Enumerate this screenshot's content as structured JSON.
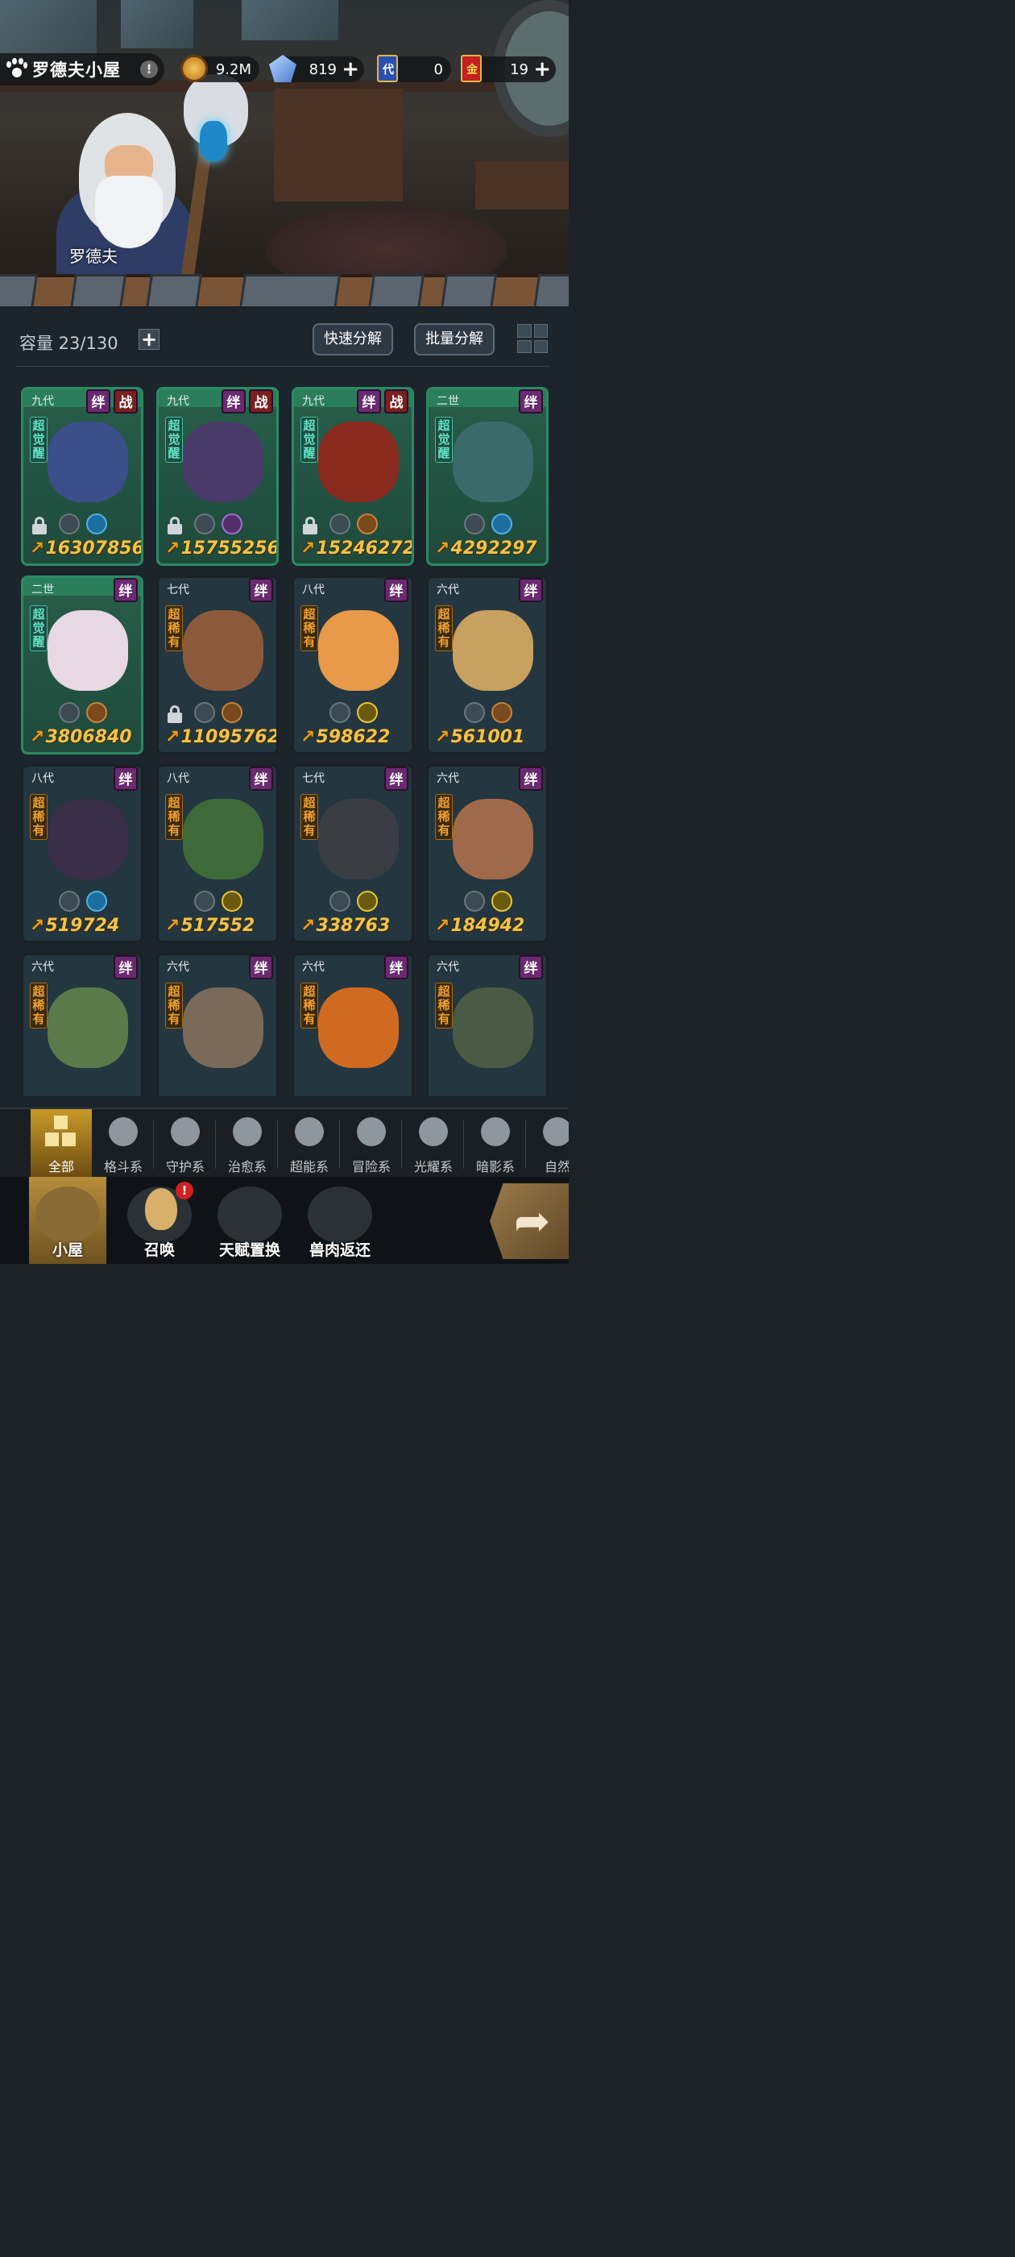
{
  "header": {
    "title": "罗德夫小屋",
    "resources": [
      {
        "name": "coin",
        "value": "9.2M",
        "plus": false
      },
      {
        "name": "crystal",
        "value": "819",
        "plus": true
      },
      {
        "name": "generation-card",
        "value": "0",
        "plus": false
      },
      {
        "name": "gold-card",
        "value": "19",
        "plus": true
      }
    ],
    "gen_card_char": "代",
    "gold_card_char": "金"
  },
  "scene": {
    "npc_name": "罗德夫"
  },
  "storage": {
    "capacity_label": "容量 23/130",
    "quick_decompose": "快速分解",
    "batch_decompose": "批量分解"
  },
  "cards": [
    {
      "tier": "九代",
      "badges": [
        "绊",
        "战"
      ],
      "tag": "超觉醒",
      "tag_type": "awk",
      "green": true,
      "locked": true,
      "elements": [
        "leaf",
        "drop"
      ],
      "power": "16307856",
      "color": "#3a4f8a"
    },
    {
      "tier": "九代",
      "badges": [
        "绊",
        "战"
      ],
      "tag": "超觉醒",
      "tag_type": "awk",
      "green": true,
      "locked": true,
      "elements": [
        "eye",
        "moon"
      ],
      "power": "15755256",
      "color": "#4a3a6a"
    },
    {
      "tier": "九代",
      "badges": [
        "绊",
        "战"
      ],
      "tag": "超觉醒",
      "tag_type": "awk",
      "green": true,
      "locked": true,
      "elements": [
        "fist",
        "shoe"
      ],
      "power": "15246272",
      "color": "#8a2a1e"
    },
    {
      "tier": "二世",
      "badges": [
        "绊"
      ],
      "tag": "超觉醒",
      "tag_type": "awk",
      "green": true,
      "locked": false,
      "elements": [
        "eye",
        "drop"
      ],
      "power": "4292297",
      "color": "#3a6a6a"
    },
    {
      "tier": "二世",
      "badges": [
        "绊"
      ],
      "tag": "超觉醒",
      "tag_type": "awk",
      "green": true,
      "locked": false,
      "elements": [
        "sprout",
        "shoe"
      ],
      "power": "3806840",
      "color": "#e8d8e4"
    },
    {
      "tier": "七代",
      "badges": [
        "绊"
      ],
      "tag": "超稀有",
      "tag_type": "rare",
      "green": false,
      "locked": true,
      "elements": [
        "shield",
        "shoe"
      ],
      "power": "11095762",
      "color": "#8a5a3a"
    },
    {
      "tier": "八代",
      "badges": [
        "绊"
      ],
      "tag": "超稀有",
      "tag_type": "rare",
      "green": false,
      "locked": false,
      "elements": [
        "cross",
        "sun"
      ],
      "power": "598622",
      "color": "#e89a4a"
    },
    {
      "tier": "六代",
      "badges": [
        "绊"
      ],
      "tag": "超稀有",
      "tag_type": "rare",
      "green": false,
      "locked": false,
      "elements": [
        "leaf",
        "shoe"
      ],
      "power": "561001",
      "color": "#c8a060"
    },
    {
      "tier": "八代",
      "badges": [
        "绊"
      ],
      "tag": "超稀有",
      "tag_type": "rare",
      "green": false,
      "locked": false,
      "elements": [
        "alien",
        "drop"
      ],
      "power": "519724",
      "color": "#3a2e48"
    },
    {
      "tier": "八代",
      "badges": [
        "绊"
      ],
      "tag": "超稀有",
      "tag_type": "rare",
      "green": false,
      "locked": false,
      "elements": [
        "shield",
        "sun"
      ],
      "power": "517552",
      "color": "#3e6a3a"
    },
    {
      "tier": "七代",
      "badges": [
        "绊"
      ],
      "tag": "超稀有",
      "tag_type": "rare",
      "green": false,
      "locked": false,
      "elements": [
        "shield",
        "sun"
      ],
      "power": "338763",
      "color": "#3a3e44"
    },
    {
      "tier": "六代",
      "badges": [
        "绊"
      ],
      "tag": "超稀有",
      "tag_type": "rare",
      "green": false,
      "locked": false,
      "elements": [
        "cross",
        "sun"
      ],
      "power": "184942",
      "color": "#a06a4a"
    },
    {
      "tier": "六代",
      "badges": [
        "绊"
      ],
      "tag": "超稀有",
      "tag_type": "rare",
      "green": false,
      "locked": false,
      "elements": [],
      "power": "",
      "color": "#5a7a4a"
    },
    {
      "tier": "六代",
      "badges": [
        "绊"
      ],
      "tag": "超稀有",
      "tag_type": "rare",
      "green": false,
      "locked": false,
      "elements": [],
      "power": "",
      "color": "#7a6a5a"
    },
    {
      "tier": "六代",
      "badges": [
        "绊"
      ],
      "tag": "超稀有",
      "tag_type": "rare",
      "green": false,
      "locked": false,
      "elements": [],
      "power": "",
      "color": "#d06a20"
    },
    {
      "tier": "六代",
      "badges": [
        "绊"
      ],
      "tag": "超稀有",
      "tag_type": "rare",
      "green": false,
      "locked": false,
      "elements": [],
      "power": "",
      "color": "#4a5a44"
    }
  ],
  "category_tabs": [
    "全部",
    "格斗系",
    "守护系",
    "治愈系",
    "超能系",
    "冒险系",
    "光耀系",
    "暗影系",
    "自然系"
  ],
  "category_visible": [
    "全部",
    "格斗系",
    "守护系",
    "治愈系",
    "超能系",
    "冒险系",
    "光耀系",
    "暗影系",
    "自然"
  ],
  "active_tab": "全部",
  "bottom_nav": [
    {
      "label": "小屋",
      "active": true
    },
    {
      "label": "召唤",
      "active": false,
      "alert": "!"
    },
    {
      "label": "天赋置换",
      "active": false
    },
    {
      "label": "兽肉返还",
      "active": false
    }
  ]
}
